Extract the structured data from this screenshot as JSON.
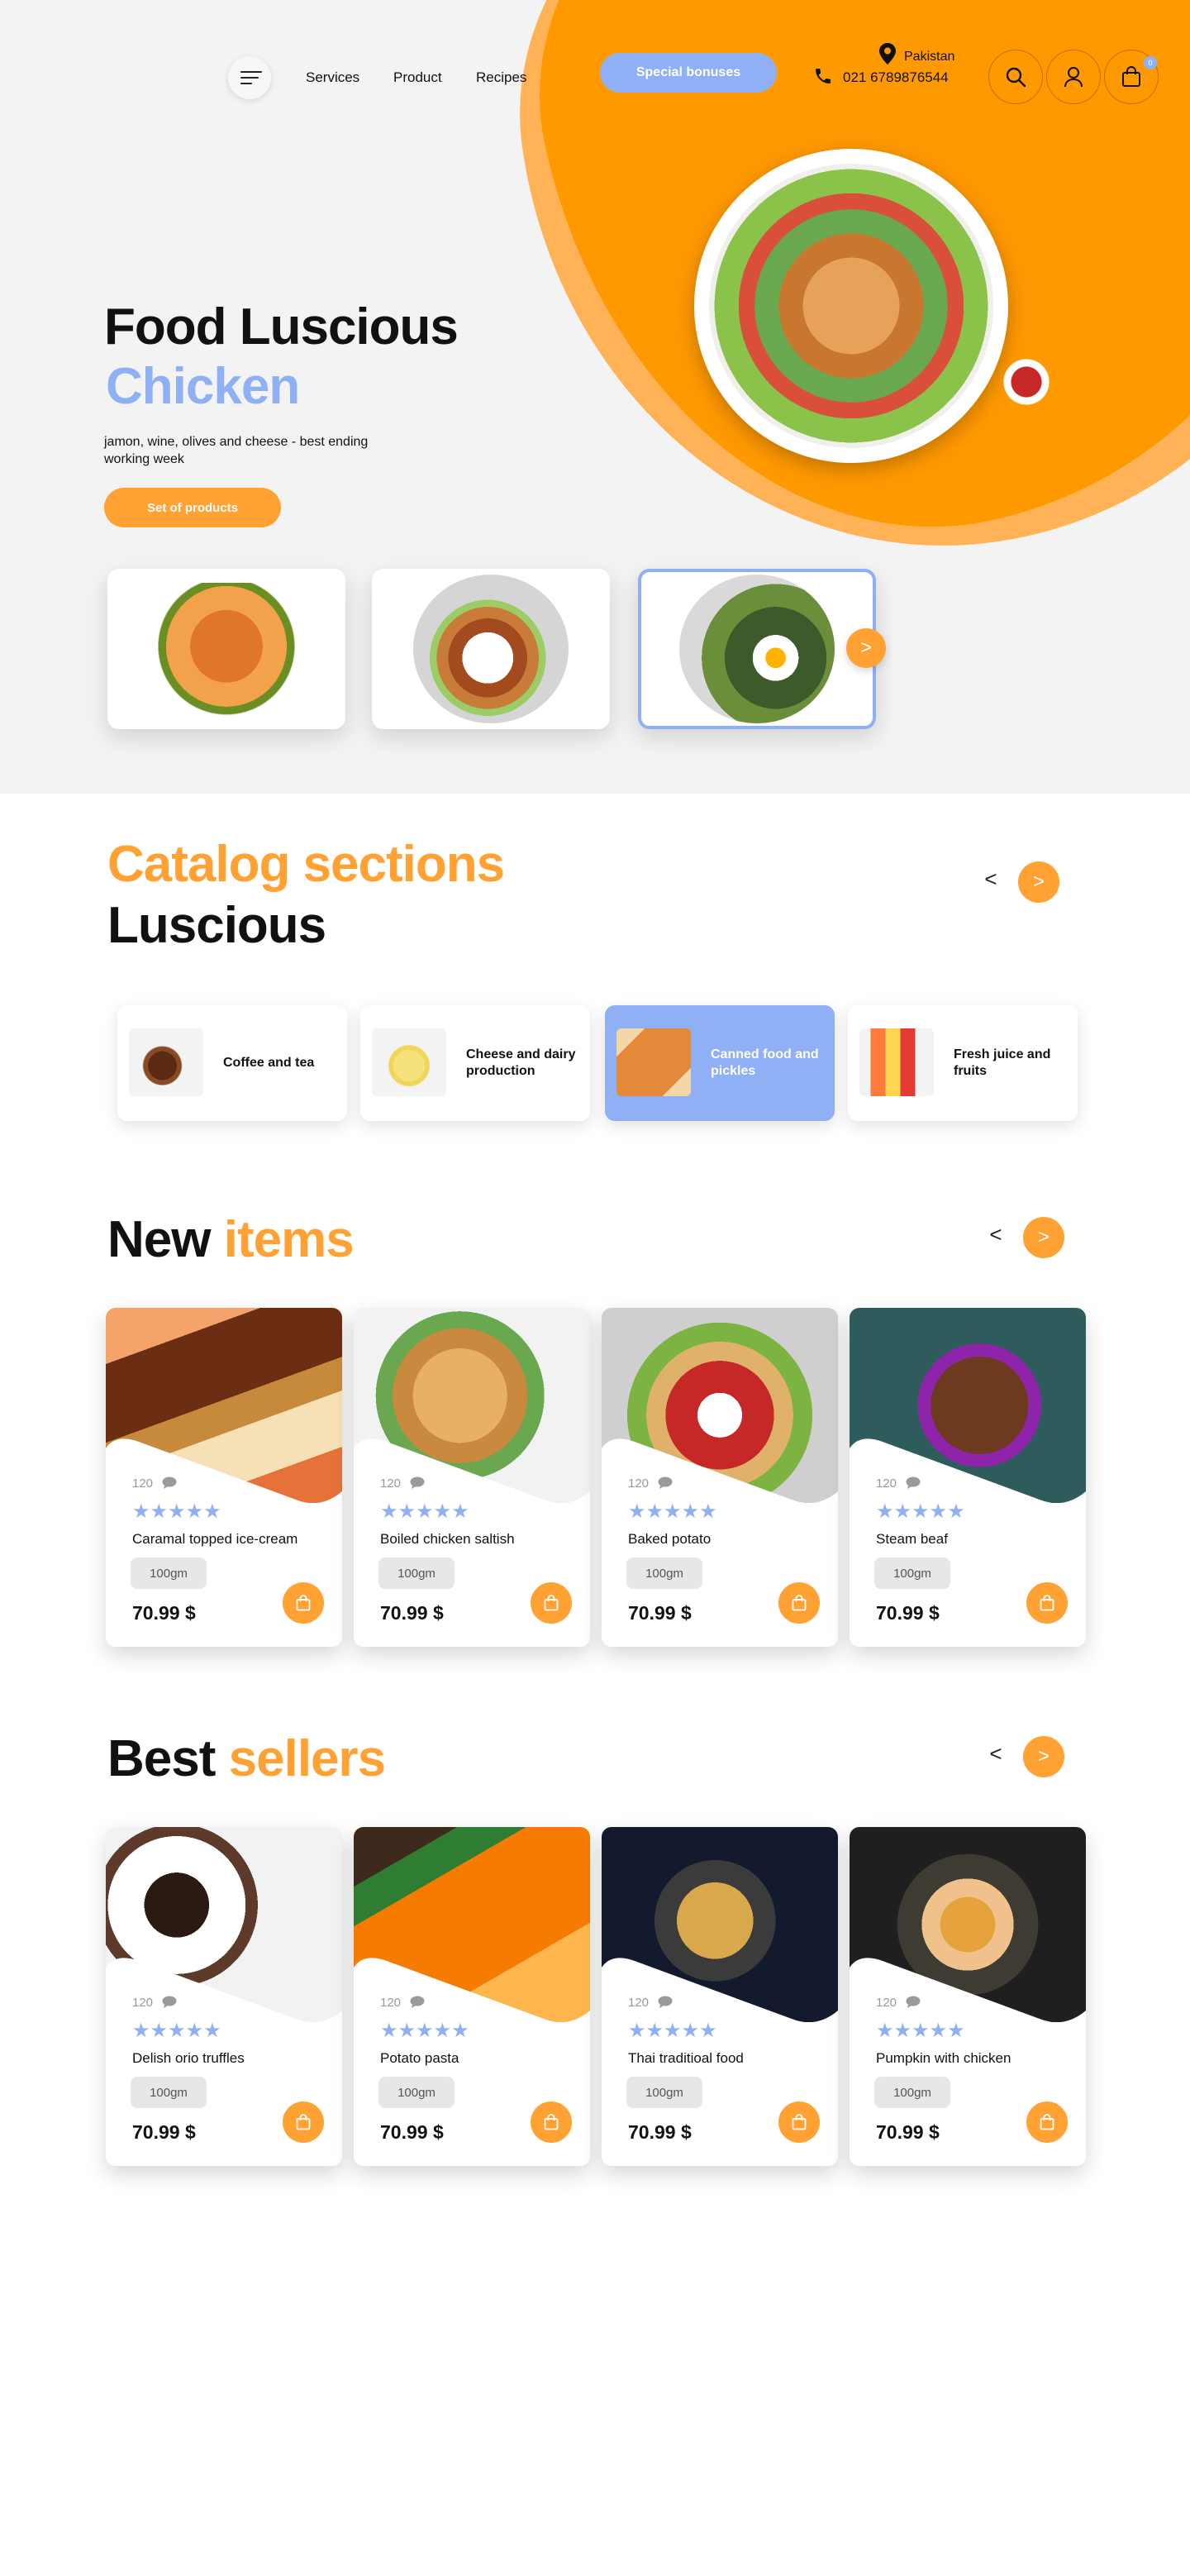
{
  "header": {
    "nav": [
      "Services",
      "Product",
      "Recipes"
    ],
    "special_button": "Special bonuses",
    "phone": "021 6789876544",
    "country": "Pakistan",
    "cart_count": "0"
  },
  "hero": {
    "title": "Food Luscious",
    "subtitle": "Chicken",
    "description": "jamon, wine, olives and cheese - best ending working week",
    "button": "Set of products",
    "next_arrow": ">"
  },
  "catalog": {
    "title_orange": "Catalog sections",
    "title_black": "Luscious",
    "prev": "<",
    "next": ">",
    "items": [
      {
        "label": "Coffee and tea"
      },
      {
        "label": "Cheese and dairy production"
      },
      {
        "label": "Canned food and pickles"
      },
      {
        "label": "Fresh juice and fruits"
      }
    ]
  },
  "new_items": {
    "title_black": "New",
    "title_orange": "items",
    "prev": "<",
    "next": ">",
    "products": [
      {
        "count": "120",
        "stars": "★★★★★",
        "name": "Caramal topped ice-cream",
        "weight": "100gm",
        "price": "70.99 $"
      },
      {
        "count": "120",
        "stars": "★★★★★",
        "name": "Boiled chicken saltish",
        "weight": "100gm",
        "price": "70.99 $"
      },
      {
        "count": "120",
        "stars": "★★★★★",
        "name": "Baked potato",
        "weight": "100gm",
        "price": "70.99 $"
      },
      {
        "count": "120",
        "stars": "★★★★★",
        "name": "Steam beaf",
        "weight": "100gm",
        "price": "70.99 $"
      }
    ]
  },
  "best_sellers": {
    "title_black": "Best",
    "title_orange": "sellers",
    "prev": "<",
    "next": ">",
    "products": [
      {
        "count": "120",
        "stars": "★★★★★",
        "name": "Delish orio truffles",
        "weight": "100gm",
        "price": "70.99 $"
      },
      {
        "count": "120",
        "stars": "★★★★★",
        "name": "Potato pasta",
        "weight": "100gm",
        "price": "70.99 $"
      },
      {
        "count": "120",
        "stars": "★★★★★",
        "name": "Thai traditioal food",
        "weight": "100gm",
        "price": "70.99 $"
      },
      {
        "count": "120",
        "stars": "★★★★★",
        "name": "Pumpkin with chicken",
        "weight": "100gm",
        "price": "70.99 $"
      }
    ]
  },
  "colors": {
    "orange": "#ffa133",
    "blue": "#8fb0f4",
    "hero_bg": "#f3f3f3"
  }
}
